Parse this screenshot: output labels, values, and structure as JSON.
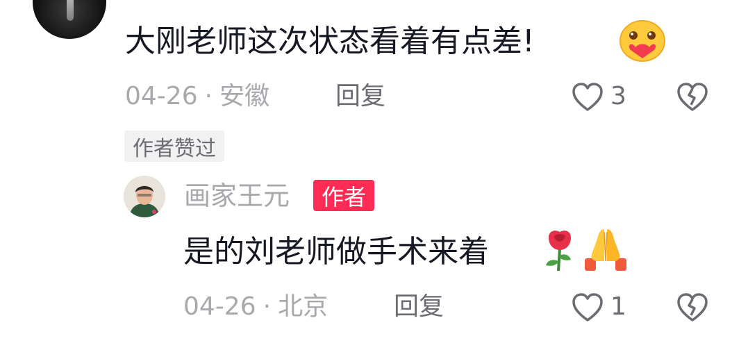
{
  "comments": [
    {
      "text": "大刚老师这次状态看着有点差!",
      "emoji": "blush-heart-emoji",
      "date": "04-26",
      "location": "安徽",
      "reply_label": "回复",
      "likes": "3",
      "author_liked_label": "作者赞过"
    }
  ],
  "reply": {
    "author": "画家王元",
    "author_badge": "作者",
    "text": "是的刘老师做手术来着",
    "emojis": [
      "rose-emoji",
      "folded-hands-emoji"
    ],
    "date": "04-26",
    "location": "北京",
    "reply_label": "回复",
    "likes": "1"
  },
  "separator": "·",
  "colors": {
    "primary_text": "#161823",
    "secondary_text": "#a8a9ad",
    "action_text": "#6b6c72",
    "author_badge_bg": "#fe2c55"
  }
}
